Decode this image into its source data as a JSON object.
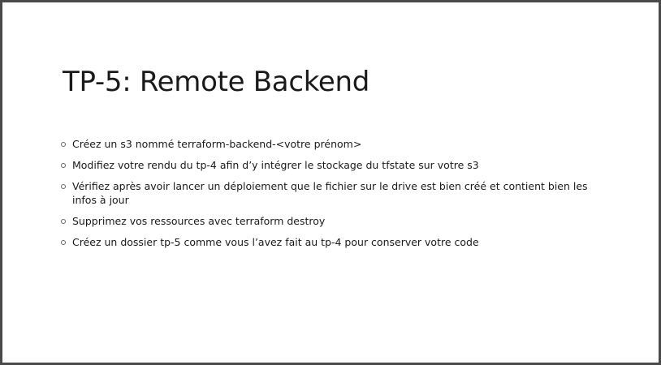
{
  "slide": {
    "title": "TP-5: Remote Backend",
    "bullets": [
      "Créez un s3 nommé terraform-backend-<votre prénom>",
      "Modifiez votre rendu du tp-4 afin d’y intégrer le stockage du tfstate sur votre s3",
      "Vérifiez après avoir lancer un déploiement que le fichier sur le drive est bien créé et contient bien les infos à jour",
      "Supprimez vos ressources avec terraform destroy",
      "Créez un dossier tp-5 comme vous l’avez fait au tp-4 pour conserver votre code"
    ]
  }
}
